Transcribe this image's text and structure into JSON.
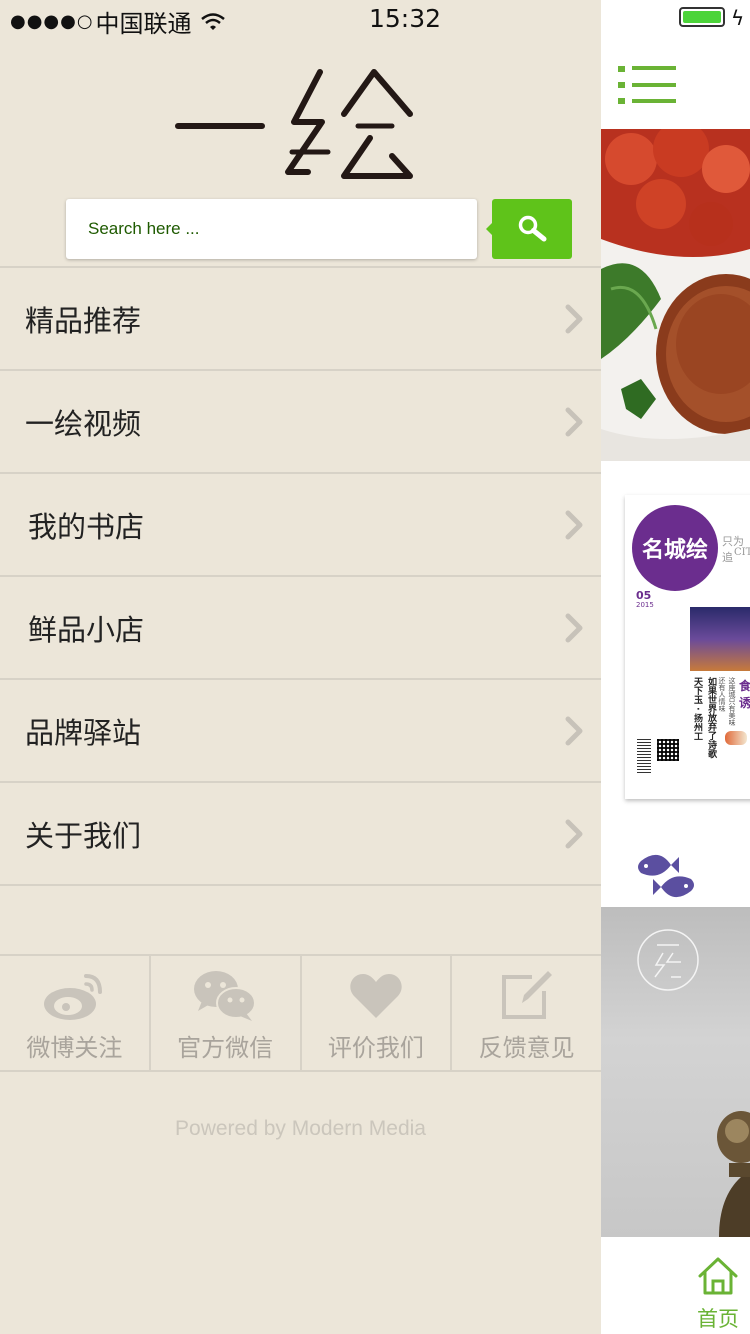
{
  "status_bar": {
    "signal_dots": "●●●●○",
    "carrier": "中国联通",
    "time": "15:32"
  },
  "search": {
    "placeholder": "Search here ..."
  },
  "menu": {
    "items": [
      {
        "label": "精品推荐"
      },
      {
        "label": "一绘视频"
      },
      {
        "label": "我的书店"
      },
      {
        "label": "鲜品小店"
      },
      {
        "label": "品牌驿站"
      },
      {
        "label": "关于我们"
      }
    ]
  },
  "social": {
    "items": [
      {
        "label": "微博关注",
        "icon": "weibo-icon"
      },
      {
        "label": "官方微信",
        "icon": "wechat-icon"
      },
      {
        "label": "评价我们",
        "icon": "heart-icon"
      },
      {
        "label": "反馈意见",
        "icon": "edit-icon"
      }
    ]
  },
  "footer": {
    "powered": "Powered by Modern Media"
  },
  "magazine": {
    "badge": "名城绘",
    "issue": "05",
    "year": "2015",
    "side_text": "只为追",
    "side_text2": "CIT",
    "feature": "食诱",
    "col1": "天下玉 · 扬州工",
    "col2": "如果世界放弃了诗歌",
    "col3": "还有人情味",
    "col4": "这座城只有美味"
  },
  "right_panel": {
    "home_label": "首页"
  },
  "colors": {
    "accent": "#5fc31a",
    "background": "#ece6d9",
    "divider": "#d7d2c7",
    "icon_gray": "#c9c4bb",
    "magazine_purple": "#6b2d8e"
  }
}
